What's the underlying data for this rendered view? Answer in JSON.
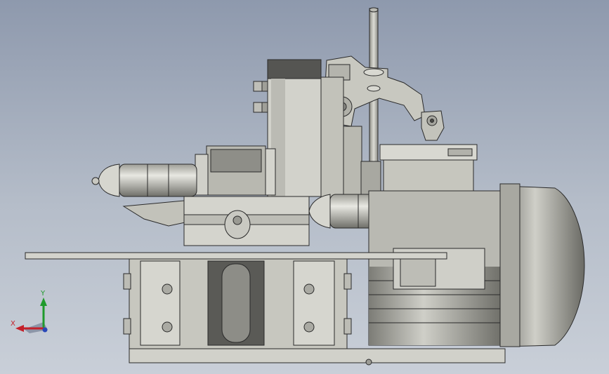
{
  "viewport": {
    "background_top": "#8e99ad",
    "background_bottom": "#c9cfd8"
  },
  "triad": {
    "x_label": "X",
    "y_label": "Y",
    "x_color": "#c4202a",
    "y_color": "#1f9a2c",
    "z_color": "#2a48b8"
  },
  "model": {
    "body_color": "#cfcfc7",
    "shadow_color": "#9a9a92",
    "dark_color": "#5c5c58",
    "outline_color": "#2a2a2a"
  }
}
